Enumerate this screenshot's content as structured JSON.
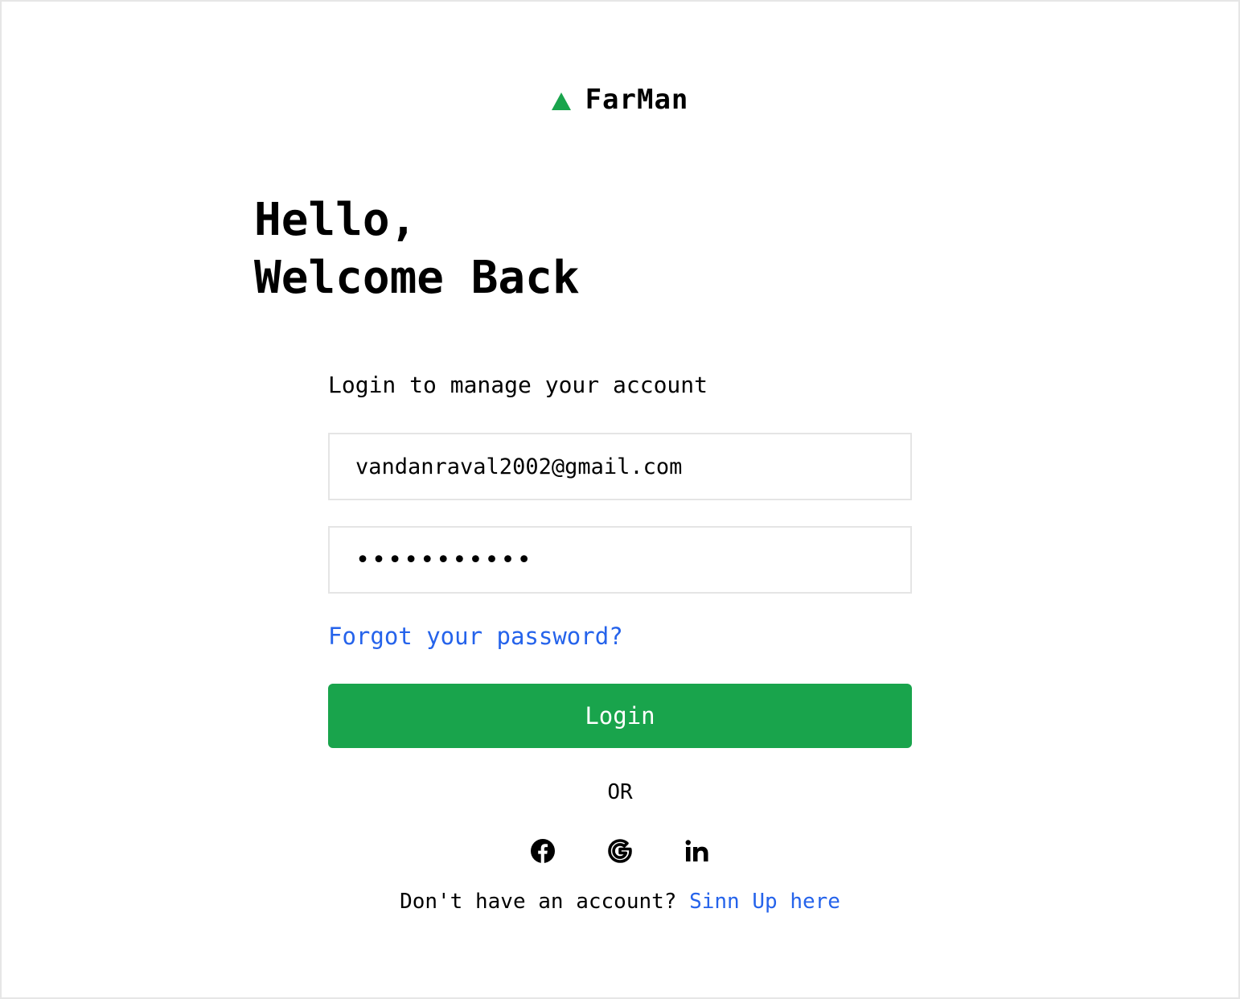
{
  "brand": {
    "name": "FarMan",
    "logo_icon": "triangle-icon",
    "accent_color": "#19a44c"
  },
  "greeting": {
    "line1": "Hello,",
    "line2": "Welcome Back"
  },
  "form": {
    "subtitle": "Login to manage your account",
    "email_value": "vandanraval2002@gmail.com",
    "password_value": "•••••••••••",
    "forgot_label": "Forgot your password?",
    "login_label": "Login"
  },
  "divider": {
    "label": "OR"
  },
  "socials": [
    {
      "icon": "facebook-icon"
    },
    {
      "icon": "google-icon"
    },
    {
      "icon": "linkedin-icon"
    }
  ],
  "signup": {
    "prompt": "Don't have an account?",
    "link_label": "Sinn Up here"
  },
  "colors": {
    "link": "#2563eb",
    "button": "#19a44c"
  }
}
